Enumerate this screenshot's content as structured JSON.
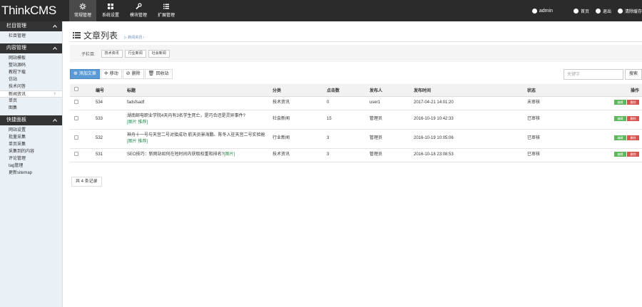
{
  "app": {
    "brand": "ThinkCMS"
  },
  "topnav": [
    {
      "label": "常规管理",
      "icon": "gear-icon",
      "active": true
    },
    {
      "label": "系统设置",
      "icon": "grid-icon",
      "active": false
    },
    {
      "label": "模块管理",
      "icon": "wrench-icon",
      "active": false
    },
    {
      "label": "扩展管理",
      "icon": "list-icon",
      "active": false
    }
  ],
  "topright": {
    "user": "admin",
    "home": "首页",
    "logout": "退出",
    "clear_cache": "清除缓存"
  },
  "sidebar": {
    "groups": [
      {
        "title": "栏目管理",
        "items": [
          "栏目管理"
        ]
      },
      {
        "title": "内容管理",
        "items": [
          "网站模板",
          "整站源码",
          "教程下载",
          "仿站",
          "技术问答",
          "新闻资讯",
          "单页",
          "图集"
        ]
      },
      {
        "title": "快捷面板",
        "items": [
          "网站设置",
          "批量采集",
          "单页采集",
          "采集到的内容",
          "评论管理",
          "tag管理",
          "更新sitemap"
        ]
      }
    ],
    "active_item": "新闻资讯"
  },
  "page": {
    "title": "文章列表",
    "breadcrumb": "▷ 新闻资讯 ›"
  },
  "subcategories": {
    "label": "子栏目:",
    "items": [
      "技术资讯",
      "行业新闻",
      "社会新闻"
    ]
  },
  "toolbar": {
    "add": "添加文章",
    "move": "移动",
    "delete": "删除",
    "recycle": "回收站"
  },
  "search": {
    "placeholder": "关键字",
    "button": "搜索"
  },
  "table": {
    "headers": {
      "id": "编号",
      "title": "标题",
      "category": "分类",
      "views": "点击数",
      "author": "发布人",
      "time": "发布时间",
      "status": "状态",
      "ops": "操作"
    },
    "rows": [
      {
        "id": "534",
        "title": "fadsfsadf",
        "tags": "",
        "category": "技术资讯",
        "views": "0",
        "author": "user1",
        "time": "2017-04-21 14:01:20",
        "status": "未审核",
        "status_color": "#999999"
      },
      {
        "id": "533",
        "title": "湖南邮电职业学院4天内有3名学生死亡，是巧合还是灵异事件?",
        "tags": "[图片 推荐]",
        "category": "社会新闻",
        "views": "15",
        "author": "管理员",
        "time": "2016-10-19 10:42:33",
        "status": "已审核",
        "status_color": "#3c9a3c"
      },
      {
        "id": "532",
        "title": "神舟十一号与天宫二号对接成功 航天员景海鹏、陈冬入驻天宫二号实验舱",
        "tags": "[图片 推荐]",
        "category": "行业新闻",
        "views": "3",
        "author": "管理员",
        "time": "2016-10-19 10:05:06",
        "status": "已审核",
        "status_color": "#3c9a3c"
      },
      {
        "id": "531",
        "title": "SEO技巧：新网站如何在短时间内获取权重和排名?",
        "tags": "[图片]",
        "category": "技术资讯",
        "views": "3",
        "author": "管理员",
        "time": "2016-10-18 23:08:53",
        "status": "已审核",
        "status_color": "#3c9a3c"
      }
    ],
    "op_edit": "编辑",
    "op_delete": "删除"
  },
  "footer": {
    "total": "共 4 条记录"
  }
}
